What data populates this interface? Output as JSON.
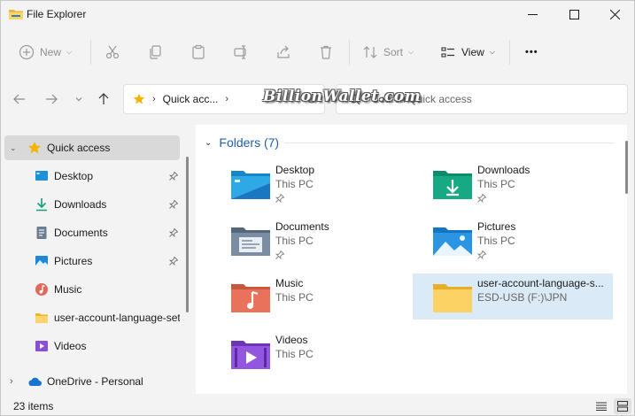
{
  "window": {
    "title": "File Explorer"
  },
  "toolbar": {
    "new_label": "New",
    "sort_label": "Sort",
    "view_label": "View",
    "more_label": "•••"
  },
  "navigation": {
    "address_location": "Quick acc...",
    "search_placeholder": "Search Quick access"
  },
  "watermark": {
    "text": "BillionWallet.com"
  },
  "sidebar": {
    "items": [
      {
        "label": "Quick access",
        "icon": "star-icon",
        "selected": true
      },
      {
        "label": "Desktop",
        "icon": "desktop-icon",
        "pinned": true
      },
      {
        "label": "Downloads",
        "icon": "download-icon",
        "pinned": true
      },
      {
        "label": "Documents",
        "icon": "documents-icon",
        "pinned": true
      },
      {
        "label": "Pictures",
        "icon": "pictures-icon",
        "pinned": true
      },
      {
        "label": "Music",
        "icon": "music-icon",
        "pinned": false
      },
      {
        "label": "user-account-language-set",
        "icon": "folder-icon",
        "pinned": false
      },
      {
        "label": "Videos",
        "icon": "videos-icon",
        "pinned": false
      },
      {
        "label": "OneDrive - Personal",
        "icon": "cloud-icon",
        "pinned": false
      }
    ]
  },
  "content": {
    "group_title": "Folders (7)",
    "folders": [
      {
        "name": "Desktop",
        "location": "This PC",
        "pinned": true,
        "icon": "desktop-folder-icon"
      },
      {
        "name": "Downloads",
        "location": "This PC",
        "pinned": true,
        "icon": "downloads-folder-icon"
      },
      {
        "name": "Documents",
        "location": "This PC",
        "pinned": true,
        "icon": "documents-folder-icon"
      },
      {
        "name": "Pictures",
        "location": "This PC",
        "pinned": true,
        "icon": "pictures-folder-icon"
      },
      {
        "name": "Music",
        "location": "This PC",
        "pinned": false,
        "icon": "music-folder-icon"
      },
      {
        "name": "user-account-language-s...",
        "location": "ESD-USB (F:)\\JPN",
        "pinned": false,
        "selected": true,
        "icon": "yellow-folder-icon"
      },
      {
        "name": "Videos",
        "location": "This PC",
        "pinned": false,
        "icon": "videos-folder-icon"
      }
    ]
  },
  "status": {
    "item_count": "23 items"
  },
  "colors": {
    "accent": "#1f5fa8",
    "selection": "#dbeaf7",
    "folder_yellow": "#f7c948"
  }
}
